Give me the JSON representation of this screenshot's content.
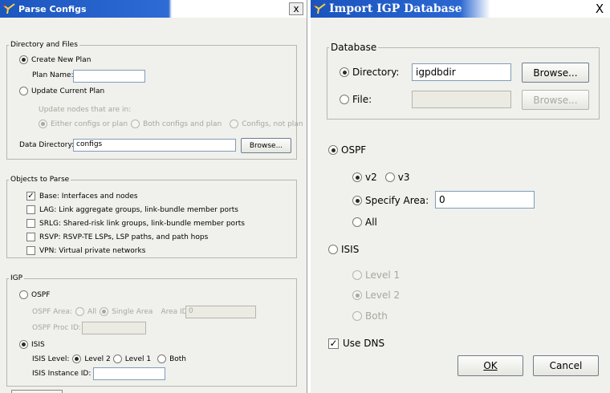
{
  "left": {
    "title": "Parse Configs",
    "close": "x",
    "dir_group": {
      "legend": "Directory and Files",
      "create_new_plan": "Create New Plan",
      "plan_name_label": "Plan Name:",
      "plan_name_value": "",
      "update_current_plan": "Update Current Plan",
      "update_nodes_label": "Update nodes that are in:",
      "opt_either": "Either configs or plan",
      "opt_both": "Both configs and plan",
      "opt_configs_not_plan": "Configs, not plan",
      "data_dir_label": "Data Directory:",
      "data_dir_value": "configs",
      "browse": "Browse..."
    },
    "objects_group": {
      "legend": "Objects to Parse",
      "items": [
        {
          "label": "Base: Interfaces and nodes",
          "checked": true
        },
        {
          "label": "LAG: Link aggregate groups, link-bundle member ports",
          "checked": false
        },
        {
          "label": "SRLG: Shared-risk link groups, link-bundle member ports",
          "checked": false
        },
        {
          "label": "RSVP: RSVP-TE LSPs, LSP paths, and path hops",
          "checked": false
        },
        {
          "label": "VPN: Virtual private networks",
          "checked": false
        }
      ]
    },
    "igp_group": {
      "legend": "IGP",
      "ospf": "OSPF",
      "ospf_area_label": "OSPF Area:",
      "ospf_area_all": "All",
      "ospf_area_single": "Single Area",
      "area_id_label": "Area ID:",
      "area_id_value": "0",
      "ospf_proc_id_label": "OSPF Proc ID:",
      "ospf_proc_id_value": "",
      "isis": "ISIS",
      "isis_level_label": "ISIS Level:",
      "level2": "Level 2",
      "level1": "Level 1",
      "both": "Both",
      "isis_instance_label": "ISIS Instance ID:",
      "isis_instance_value": ""
    }
  },
  "right": {
    "title": "Import IGP Database",
    "close": "X",
    "db_group": {
      "legend": "Database",
      "directory_label": "Directory:",
      "directory_value": "igpdbdir",
      "file_label": "File:",
      "file_value": "",
      "browse1": "Browse...",
      "browse2": "Browse..."
    },
    "ospf": "OSPF",
    "v2": "v2",
    "v3": "v3",
    "specify_area": "Specify Area:",
    "specify_area_value": "0",
    "all": "All",
    "isis": "ISIS",
    "level1": "Level 1",
    "level2": "Level 2",
    "both": "Both",
    "use_dns": "Use DNS",
    "ok": "OK",
    "cancel": "Cancel"
  },
  "colors": {
    "titlebar": "#1f57c6",
    "dialog_bg": "#f0f0ec"
  }
}
